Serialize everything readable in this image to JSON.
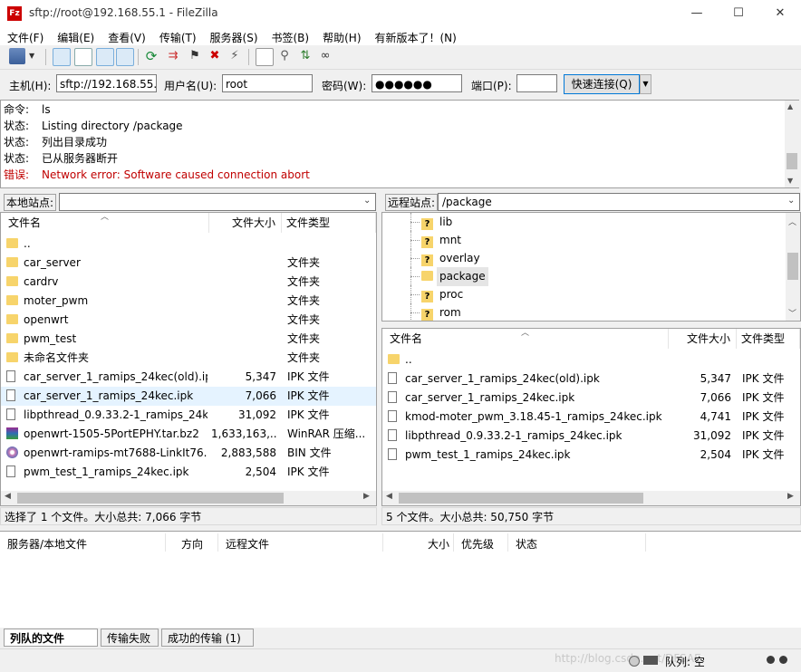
{
  "window": {
    "title": "sftp://root@192.168.55.1 - FileZilla",
    "app_icon": "Fz",
    "minimize": "—",
    "maximize": "☐",
    "close": "✕"
  },
  "menu": [
    "文件(F)",
    "编辑(E)",
    "查看(V)",
    "传输(T)",
    "服务器(S)",
    "书签(B)",
    "帮助(H)",
    "有新版本了！(N)"
  ],
  "quickconnect": {
    "host_label": "主机(H):",
    "host_value": "sftp://192.168.55.",
    "user_label": "用户名(U):",
    "user_value": "root",
    "pass_label": "密码(W):",
    "pass_value": "●●●●●●",
    "port_label": "端口(P):",
    "port_value": "",
    "connect_label": "快速连接(Q)"
  },
  "log": [
    {
      "k": "命令:",
      "v": "ls",
      "type": "cmd"
    },
    {
      "k": "状态:",
      "v": "Listing directory /package",
      "type": "status"
    },
    {
      "k": "状态:",
      "v": "列出目录成功",
      "type": "status"
    },
    {
      "k": "状态:",
      "v": "已从服务器断开",
      "type": "status"
    },
    {
      "k": "错误:",
      "v": "Network error: Software caused connection abort",
      "type": "error"
    }
  ],
  "local": {
    "site_label": "本地站点:",
    "site_value": "",
    "columns": {
      "name": "文件名",
      "size": "文件大小",
      "type": "文件类型"
    },
    "files": [
      {
        "name": "..",
        "size": "",
        "type": "",
        "icon": "folder"
      },
      {
        "name": "car_server",
        "size": "",
        "type": "文件夹",
        "icon": "folder"
      },
      {
        "name": "cardrv",
        "size": "",
        "type": "文件夹",
        "icon": "folder"
      },
      {
        "name": "moter_pwm",
        "size": "",
        "type": "文件夹",
        "icon": "folder"
      },
      {
        "name": "openwrt",
        "size": "",
        "type": "文件夹",
        "icon": "folder"
      },
      {
        "name": "pwm_test",
        "size": "",
        "type": "文件夹",
        "icon": "folder"
      },
      {
        "name": "未命名文件夹",
        "size": "",
        "type": "文件夹",
        "icon": "folder"
      },
      {
        "name": "car_server_1_ramips_24kec(old).ipk",
        "size": "5,347",
        "type": "IPK 文件",
        "icon": "file"
      },
      {
        "name": "car_server_1_ramips_24kec.ipk",
        "size": "7,066",
        "type": "IPK 文件",
        "icon": "file",
        "selected": true
      },
      {
        "name": "libpthread_0.9.33.2-1_ramips_24k...",
        "size": "31,092",
        "type": "IPK 文件",
        "icon": "file"
      },
      {
        "name": "openwrt-1505-5PortEPHY.tar.bz2",
        "size": "1,633,163,...",
        "type": "WinRAR 压缩...",
        "icon": "rar"
      },
      {
        "name": "openwrt-ramips-mt7688-LinkIt76...",
        "size": "2,883,588",
        "type": "BIN 文件",
        "icon": "bin"
      },
      {
        "name": "pwm_test_1_ramips_24kec.ipk",
        "size": "2,504",
        "type": "IPK 文件",
        "icon": "file"
      }
    ],
    "status": "选择了 1 个文件。大小总共: 7,066 字节"
  },
  "remote": {
    "site_label": "远程站点:",
    "site_value": "/package",
    "tree": [
      {
        "name": "lib",
        "icon": "unknown"
      },
      {
        "name": "mnt",
        "icon": "unknown"
      },
      {
        "name": "overlay",
        "icon": "unknown"
      },
      {
        "name": "package",
        "icon": "folder",
        "selected": true
      },
      {
        "name": "proc",
        "icon": "unknown"
      },
      {
        "name": "rom",
        "icon": "unknown"
      }
    ],
    "columns": {
      "name": "文件名",
      "size": "文件大小",
      "type": "文件类型"
    },
    "files": [
      {
        "name": "..",
        "size": "",
        "type": "",
        "icon": "folder"
      },
      {
        "name": "car_server_1_ramips_24kec(old).ipk",
        "size": "5,347",
        "type": "IPK 文件",
        "icon": "file"
      },
      {
        "name": "car_server_1_ramips_24kec.ipk",
        "size": "7,066",
        "type": "IPK 文件",
        "icon": "file"
      },
      {
        "name": "kmod-moter_pwm_3.18.45-1_ramips_24kec.ipk",
        "size": "4,741",
        "type": "IPK 文件",
        "icon": "file"
      },
      {
        "name": "libpthread_0.9.33.2-1_ramips_24kec.ipk",
        "size": "31,092",
        "type": "IPK 文件",
        "icon": "file"
      },
      {
        "name": "pwm_test_1_ramips_24kec.ipk",
        "size": "2,504",
        "type": "IPK 文件",
        "icon": "file"
      }
    ],
    "status": "5 个文件。大小总共: 50,750 字节"
  },
  "queue": {
    "columns": {
      "server": "服务器/本地文件",
      "direction": "方向",
      "remote": "远程文件",
      "size": "大小",
      "priority": "优先级",
      "status": "状态"
    }
  },
  "tabs": [
    "列队的文件",
    "传输失败",
    "成功的传输 (1)"
  ],
  "statusbar": {
    "queue_label": "队列: 空",
    "watermark": "http://blog.csdn.net/DFSAE"
  },
  "colors": {
    "error": "#c00000",
    "selected_row": "#e5f3ff",
    "accent": "#0078d7"
  }
}
